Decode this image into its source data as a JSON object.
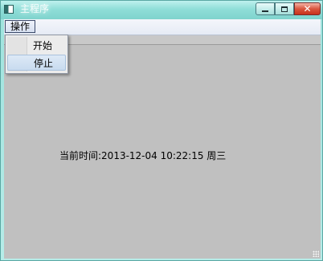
{
  "window": {
    "title": "主程序",
    "accent": "#8fded8",
    "client_bg": "#c0c0c0"
  },
  "titlebar": {
    "icon": "app-window-icon",
    "buttons": {
      "minimize_icon": "minimize-icon",
      "maximize_icon": "maximize-icon",
      "close_icon": "close-icon",
      "close_glyph": "✕",
      "close_color": "#c8321c"
    }
  },
  "menubar": {
    "items": [
      {
        "label": "操作"
      }
    ]
  },
  "dropdown": {
    "items": [
      {
        "label": "开始",
        "highlighted": false
      },
      {
        "label": "停止",
        "highlighted": true
      }
    ]
  },
  "main": {
    "clock_text": "当前时间:2013-12-04 10:22:15 周三"
  }
}
